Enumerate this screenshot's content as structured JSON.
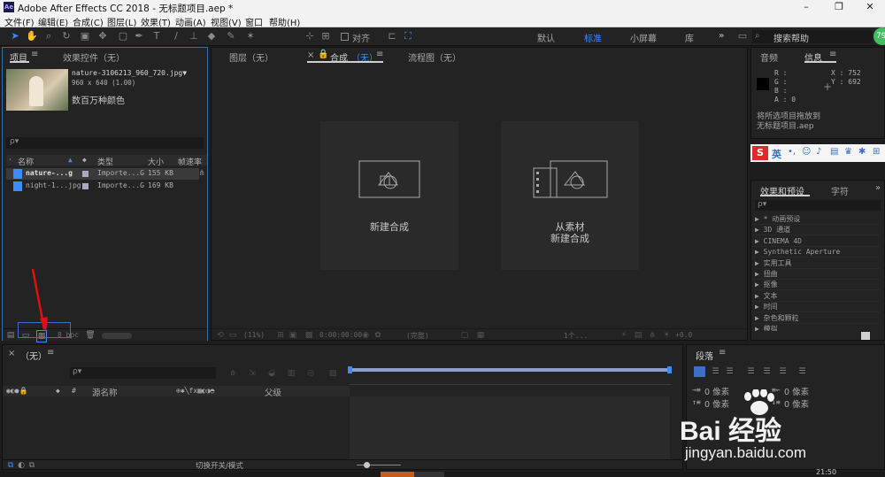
{
  "titlebar": {
    "app_icon": "Ae",
    "title": "Adobe After Effects CC 2018 - 无标题项目.aep *",
    "minimize": "–",
    "maximize": "❐",
    "close": "✕"
  },
  "menu": [
    "文件(F)",
    "编辑(E)",
    "合成(C)",
    "图层(L)",
    "效果(T)",
    "动画(A)",
    "视图(V)",
    "窗口",
    "帮助(H)"
  ],
  "toolbar": {
    "align_label": "对齐",
    "workspaces": [
      "默认",
      "标准",
      "小屏幕",
      "库"
    ],
    "active_workspace": "标准",
    "more": "»",
    "search_placeholder": "搜索帮助",
    "avatar": "79"
  },
  "project_panel": {
    "tab_project": "项目",
    "tab_effects": "效果控件（无）",
    "preview": {
      "filename": "nature-3106213_960_720.jpg▼",
      "dims": "960 x 640 (1.00)",
      "colors": "数百万种颜色"
    },
    "search_placeholder": "ρ▾",
    "columns": [
      "名称",
      "类型",
      "大小",
      "帧速率"
    ],
    "rows": [
      {
        "name": "nature-...g",
        "type": "Importe...G",
        "size": "155 KB"
      },
      {
        "name": "night-1...jpg",
        "type": "Importe...G",
        "size": "169 KB"
      }
    ],
    "bpc": "8 bpc"
  },
  "viewer": {
    "tab_layer": "图层（无）",
    "tab_comp_prefix": "合成",
    "tab_comp_suffix": "（无）",
    "tab_flow": "流程图（无）",
    "card1": "新建合成",
    "card2_line1": "从素材",
    "card2_line2": "新建合成",
    "zoom": "(11%)",
    "timecode": "0:00:00:00",
    "resolution": "(完整)",
    "views": "1个...",
    "exposure": "+0.0"
  },
  "info_panel": {
    "tab_audio": "音频",
    "tab_info": "信息",
    "r": "R :",
    "g": "G :",
    "b": "B :",
    "a": "A : 0",
    "x": "X : 752",
    "y": "Y : 692",
    "msg1": "将所选项目拖放到",
    "msg2": "无标题项目.aep"
  },
  "effects_panel": {
    "tab": "效果和预设",
    "tab2": "字符",
    "search_placeholder": "ρ▾",
    "items": [
      "▶ * 动画预设",
      "▶ 3D 通道",
      "▶ CINEMA 4D",
      "▶ Synthetic Aperture",
      "▶ 实用工具",
      "▶ 扭曲",
      "▶ 抠像",
      "▶ 文本",
      "▶ 时间",
      "▶ 杂色和颗粒",
      "▶ 模拟"
    ]
  },
  "ime": {
    "logo": "S",
    "label": "英"
  },
  "timeline": {
    "tab": "（无）",
    "search_placeholder": "ρ▾",
    "col_source": "源名称",
    "col_parent": "父级",
    "switch_label": "切换开关/模式"
  },
  "paragraph_panel": {
    "tab": "段落",
    "indent1": "0 像素",
    "indent2": "0 像素",
    "indent3": "0 像素",
    "indent4": "0 像素"
  },
  "watermark": {
    "text": "Bai 经验",
    "url": "jingyan.baidu.com"
  },
  "clock": "21:50"
}
